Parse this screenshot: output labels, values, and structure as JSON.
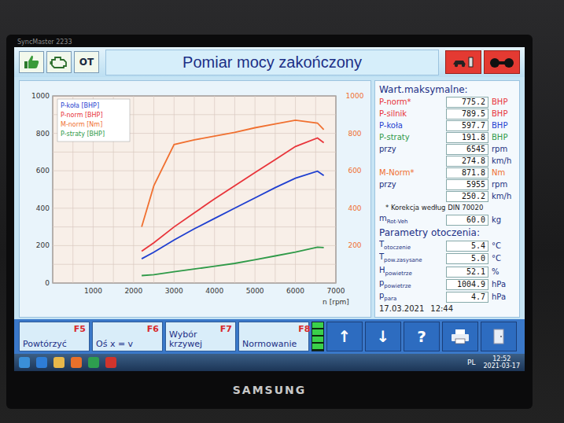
{
  "monitor": {
    "model": "SyncMaster 2233",
    "brand": "SAMSUNG"
  },
  "header": {
    "title": "Pomiar mocy zakończony",
    "left_buttons": [
      {
        "kind": "thumb",
        "label": ""
      },
      {
        "kind": "engine",
        "label": ""
      },
      {
        "kind": "text",
        "label": "OT"
      }
    ],
    "right_buttons": [
      {
        "kind": "car"
      },
      {
        "kind": "oto"
      }
    ]
  },
  "chart": {
    "x_ticks": [
      "1000",
      "2000",
      "3000",
      "4000",
      "5000",
      "6000",
      "7000"
    ],
    "y_ticks": [
      "0",
      "200",
      "400",
      "600",
      "800",
      "1000"
    ],
    "y2_ticks": [
      "200",
      "400",
      "600",
      "800",
      "1000"
    ],
    "x_label": "n [rpm]",
    "rpm": [
      2200,
      2500,
      3000,
      3500,
      4000,
      4500,
      5000,
      5500,
      6000,
      6545,
      6700
    ],
    "series": [
      {
        "name": "P-koła [BHP]",
        "color": "#1f3fd0",
        "axis": "left",
        "values": [
          130,
          165,
          230,
          290,
          345,
          400,
          455,
          510,
          560,
          597.7,
          575
        ]
      },
      {
        "name": "P-norm [BHP]",
        "color": "#e8343a",
        "axis": "left",
        "values": [
          170,
          215,
          300,
          375,
          450,
          520,
          590,
          660,
          730,
          775.2,
          750
        ]
      },
      {
        "name": "M-norm [Nm]",
        "color": "#f07030",
        "axis": "right",
        "values": [
          300,
          520,
          740,
          765,
          785,
          805,
          830,
          850,
          870,
          855,
          820
        ]
      },
      {
        "name": "P-straty [BHP]",
        "color": "#2f9a48",
        "axis": "left",
        "values": [
          40,
          45,
          60,
          75,
          90,
          105,
          125,
          145,
          165,
          191.8,
          190
        ]
      }
    ]
  },
  "results": {
    "title": "Wart.maksymalne:",
    "rows": [
      {
        "label": "P-norm*",
        "value": "775.2",
        "unit": "BHP",
        "color": "#e8343a"
      },
      {
        "label": "P-silnik",
        "value": "789.5",
        "unit": "BHP",
        "color": "#e8343a"
      },
      {
        "label": "P-koła",
        "value": "597.7",
        "unit": "BHP",
        "color": "#1f3fd0"
      },
      {
        "label": "P-straty",
        "value": "191.8",
        "unit": "BHP",
        "color": "#2f9a48"
      },
      {
        "label": "przy",
        "value": "6545",
        "unit": "rpm",
        "color": "#1a2f80"
      },
      {
        "label": "",
        "value": "274.8",
        "unit": "km/h",
        "color": "#1a2f80"
      },
      {
        "label": "M-Norm*",
        "value": "871.8",
        "unit": "Nm",
        "color": "#f07030"
      },
      {
        "label": "przy",
        "value": "5955",
        "unit": "rpm",
        "color": "#1a2f80"
      },
      {
        "label": "",
        "value": "250.2",
        "unit": "km/h",
        "color": "#1a2f80"
      }
    ],
    "note": "* Korekcja według DIN 70020",
    "mass": {
      "label": "m",
      "sub": "Rot-Veh",
      "value": "60.0",
      "unit": "kg"
    }
  },
  "ambient": {
    "title": "Parametry otoczenia:",
    "rows": [
      {
        "label": "T",
        "sub": "otoczenie",
        "value": "5.4",
        "unit": "°C"
      },
      {
        "label": "T",
        "sub": "pow.zasysane",
        "value": "5.0",
        "unit": "°C"
      },
      {
        "label": "H",
        "sub": "powietrze",
        "value": "52.1",
        "unit": "%"
      },
      {
        "label": "p",
        "sub": "powietrze",
        "value": "1004.9",
        "unit": "hPa"
      },
      {
        "label": "p",
        "sub": "para",
        "value": "4.7",
        "unit": "hPa"
      }
    ]
  },
  "date": "17.03.2021",
  "time": "12:44",
  "function_keys": [
    {
      "label": "Powtórzyć",
      "key": "F5"
    },
    {
      "label": "Oś x = v",
      "key": "F6"
    },
    {
      "label": "Wybór krzywej",
      "key": "F7"
    },
    {
      "label": "Normowanie",
      "key": "F8"
    }
  ],
  "indicator": {
    "level": 1
  },
  "nav_buttons": [
    {
      "kind": "glyph",
      "label": "↑"
    },
    {
      "kind": "glyph",
      "label": "↓"
    },
    {
      "kind": "glyph",
      "label": "?"
    },
    {
      "kind": "printer",
      "label": ""
    },
    {
      "kind": "exit",
      "label": ""
    }
  ],
  "taskbar": {
    "apps": [
      {
        "color": "#3a8fd8"
      },
      {
        "color": "#2e7dd6"
      },
      {
        "color": "#e8b84a"
      },
      {
        "color": "#e8702a"
      },
      {
        "color": "#2e9e4f"
      },
      {
        "color": "#d0342c"
      }
    ],
    "language": "PL",
    "time": "12:52",
    "date": "2021-03-17"
  }
}
